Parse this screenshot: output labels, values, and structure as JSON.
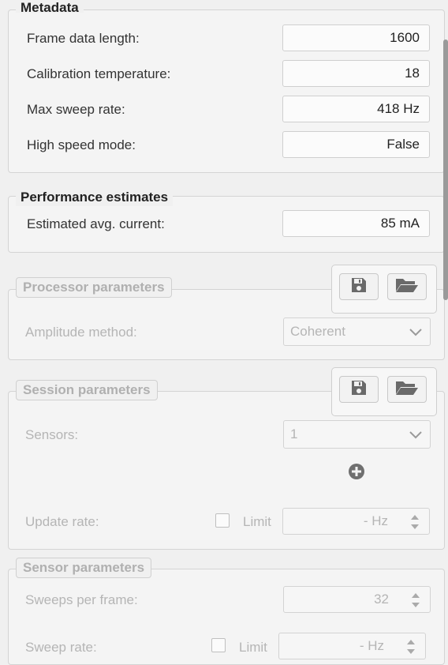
{
  "metadata": {
    "title": "Metadata",
    "rows": [
      {
        "label": "Frame data length:",
        "value": "1600"
      },
      {
        "label": "Calibration temperature:",
        "value": "18"
      },
      {
        "label": "Max sweep rate:",
        "value": "418 Hz"
      },
      {
        "label": "High speed mode:",
        "value": "False"
      }
    ]
  },
  "performance": {
    "title": "Performance estimates",
    "rows": [
      {
        "label": "Estimated avg. current:",
        "value": "85 mA"
      }
    ]
  },
  "processor": {
    "title": "Processor parameters",
    "amplitude_label": "Amplitude method:",
    "amplitude_value": "Coherent",
    "save_icon": "save-icon",
    "load_icon": "folder-open-icon"
  },
  "session": {
    "title": "Session parameters",
    "sensors_label": "Sensors:",
    "sensors_value": "1",
    "add_icon": "plus-circle-icon",
    "update_rate_label": "Update rate:",
    "limit_label": "Limit",
    "update_rate_value": "- Hz"
  },
  "sensor": {
    "title": "Sensor parameters",
    "sweeps_label": "Sweeps per frame:",
    "sweeps_value": "32",
    "sweep_rate_label": "Sweep rate:",
    "limit_label": "Limit",
    "sweep_rate_value": "- Hz"
  }
}
